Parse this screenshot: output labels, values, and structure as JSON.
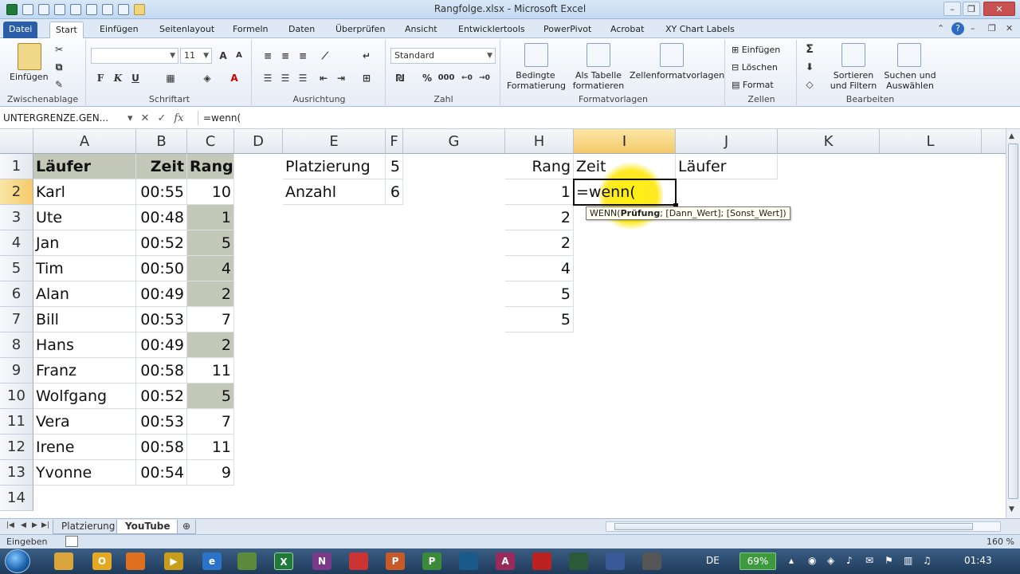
{
  "window": {
    "title": "Rangfolge.xlsx - Microsoft Excel",
    "controls": [
      "–",
      "❐",
      "✕"
    ]
  },
  "ribbon_tabs": [
    "Datei",
    "Start",
    "Einfügen",
    "Seitenlayout",
    "Formeln",
    "Daten",
    "Überprüfen",
    "Ansicht",
    "Entwicklertools",
    "PowerPivot",
    "Acrobat",
    "XY Chart Labels"
  ],
  "ribbon": {
    "clipboard": {
      "paste": "Einfügen",
      "label": "Zwischenablage"
    },
    "font": {
      "name": "",
      "size": "11",
      "bold": "F",
      "italic": "K",
      "underline": "U",
      "label": "Schriftart"
    },
    "alignment": {
      "label": "Ausrichtung"
    },
    "number": {
      "format": "Standard",
      "label": "Zahl",
      "percent": "%",
      "thousands": "000"
    },
    "styles": {
      "conditional_line1": "Bedingte",
      "conditional_line2": "Formatierung",
      "table_line1": "Als Tabelle",
      "table_line2": "formatieren",
      "cellstyles": "Zellenformatvorlagen",
      "label": "Formatvorlagen"
    },
    "cells": {
      "insert": "Einfügen",
      "delete": "Löschen",
      "format": "Format",
      "label": "Zellen"
    },
    "editing": {
      "sort_line1": "Sortieren",
      "sort_line2": "und Filtern",
      "find_line1": "Suchen und",
      "find_line2": "Auswählen",
      "label": "Bearbeiten"
    }
  },
  "formula_bar": {
    "name_box": "UNTERGRENZE.GEN...",
    "fx": "fx",
    "formula": "=wenn("
  },
  "columns": [
    "A",
    "B",
    "C",
    "D",
    "E",
    "F",
    "G",
    "H",
    "I",
    "J",
    "K",
    "L"
  ],
  "rows": [
    "1",
    "2",
    "3",
    "4",
    "5",
    "6",
    "7",
    "8",
    "9",
    "10",
    "11",
    "12",
    "13",
    "14"
  ],
  "cells": {
    "A1": "Läufer",
    "B1": "Zeit",
    "C1": "Rang",
    "E1": "Platzierung",
    "F1": "5",
    "H1": "Rang",
    "I1": "Zeit",
    "J1": "Läufer",
    "E2": "Anzahl",
    "F2": "6",
    "I2": "=wenn(",
    "A2": "Karl",
    "B2": "00:55",
    "C2": "10",
    "H2": "1",
    "A3": "Ute",
    "B3": "00:48",
    "C3": "1",
    "H3": "2",
    "A4": "Jan",
    "B4": "00:52",
    "C4": "5",
    "H4": "2",
    "A5": "Tim",
    "B5": "00:50",
    "C5": "4",
    "H5": "4",
    "A6": "Alan",
    "B6": "00:49",
    "C6": "2",
    "H6": "5",
    "A7": "Bill",
    "B7": "00:53",
    "C7": "7",
    "H7": "5",
    "A8": "Hans",
    "B8": "00:49",
    "C8": "2",
    "A9": "Franz",
    "B9": "00:58",
    "C9": "11",
    "A10": "Wolfgang",
    "B10": "00:52",
    "C10": "5",
    "A11": "Vera",
    "B11": "00:53",
    "C11": "7",
    "A12": "Irene",
    "B12": "00:58",
    "C12": "11",
    "A13": "Yvonne",
    "B13": "00:54",
    "C13": "9"
  },
  "tooltip": {
    "func": "WENN(",
    "arg1": "Prüfung",
    "rest": "; [Dann_Wert]; [Sonst_Wert])"
  },
  "sheets": [
    "Platzierung",
    "YouTube"
  ],
  "active_sheet": "YouTube",
  "status": {
    "mode": "Eingeben",
    "zoom": "160 %"
  },
  "taskbar": {
    "language": "DE",
    "battery": "69%",
    "time": "01:43"
  },
  "colors": {
    "highlight": "#c4c8b8",
    "selected_header": "#f5c96a",
    "cursor_spot": "#ffe600"
  }
}
